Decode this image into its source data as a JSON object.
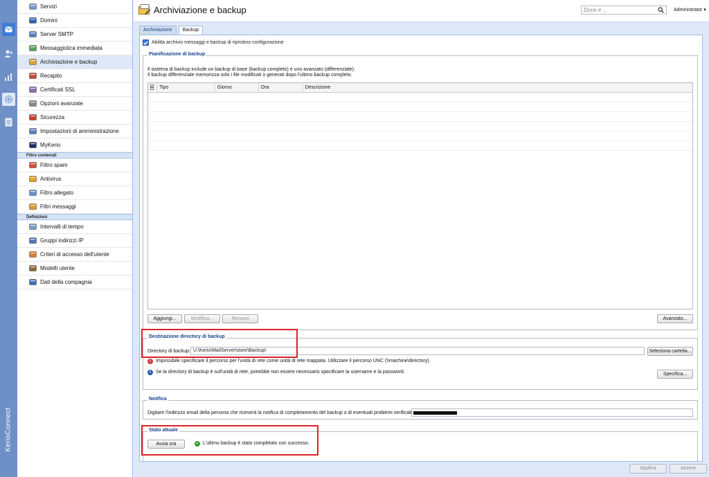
{
  "rail": {
    "brand": "KerioConnect"
  },
  "sidebar": {
    "items_top": [
      {
        "label": "Servizi",
        "icon": "services-icon"
      },
      {
        "label": "Domini",
        "icon": "at-icon"
      },
      {
        "label": "Server SMTP",
        "icon": "smtp-icon"
      },
      {
        "label": "Messaggistica immediata",
        "icon": "chat-icon"
      },
      {
        "label": "Archiviazione e backup",
        "icon": "archive-icon"
      },
      {
        "label": "Recapito",
        "icon": "delivery-icon"
      },
      {
        "label": "Certificati SSL",
        "icon": "certificate-icon"
      },
      {
        "label": "Opzioni avanzate",
        "icon": "gear-icon"
      },
      {
        "label": "Sicurezza",
        "icon": "security-icon"
      },
      {
        "label": "Impostazioni di amministrazione",
        "icon": "admin-settings-icon"
      },
      {
        "label": "MyKerio",
        "icon": "mykerio-icon"
      }
    ],
    "section_filters": "Filtro contenuti",
    "items_filters": [
      {
        "label": "Filtro spam",
        "icon": "spam-filter-icon"
      },
      {
        "label": "Antivirus",
        "icon": "antivirus-icon"
      },
      {
        "label": "Filtro allegato",
        "icon": "attachment-filter-icon"
      },
      {
        "label": "Filtri messaggi",
        "icon": "message-filter-icon"
      }
    ],
    "section_definitions": "Definizioni",
    "items_definitions": [
      {
        "label": "Intervalli di tempo",
        "icon": "time-interval-icon"
      },
      {
        "label": "Gruppi indirizzi IP",
        "icon": "ip-group-icon"
      },
      {
        "label": "Criteri di accesso dell'utente",
        "icon": "access-policy-icon"
      },
      {
        "label": "Modelli utente",
        "icon": "user-template-icon"
      },
      {
        "label": "Dati della compagnia",
        "icon": "company-data-icon"
      }
    ]
  },
  "header": {
    "title": "Archiviazione e backup",
    "search_placeholder": "Dove è ...",
    "user": "Administrator"
  },
  "tabs": [
    {
      "label": "Archiviazione"
    },
    {
      "label": "Backup"
    }
  ],
  "backup": {
    "enable_label": "Abilita archivio messaggi e backup di ripristino configurazione",
    "schedule": {
      "legend": "Pianificazione di backup",
      "desc1": "Il sistema di backup include un backup di base (backup completo) e uno avanzato (differenziale).",
      "desc2": "Il backup differenziale memorizza solo i file modificati o generati dopo l'ultimo backup completo.",
      "columns": [
        "Tipo",
        "Giorno",
        "Ora",
        "Descrizione"
      ],
      "btn_add": "Aggiungi...",
      "btn_edit": "Modifica...",
      "btn_remove": "Rimuovi",
      "btn_advanced": "Avanzato..."
    },
    "destination": {
      "legend": "Destinazione directory di backup",
      "label": "Directory di backup:",
      "value": "U:\\Kerio\\MailServer\\store\\Backup\\",
      "btn_select": "Seleziona cartella...",
      "error_text": "Impossibile specificare il percorso per l'unità di rete come unità di rete mappata. Utilizzare il percorso UNC (\\\\machine\\directory).",
      "info_text": "Se la directory di backup è sull'unità di rete, potrebbe non essere necessario specificare la username e la password.",
      "btn_specify": "Specifica..."
    },
    "notification": {
      "legend": "Notifica",
      "label": "Digitare l'indirizzo email della persona che riceverà la notifica di completamento del backup o di eventuali problemi verificatisi:"
    },
    "status": {
      "legend": "Stato attuale",
      "btn_start": "Avvia ora",
      "message": "L'ultimo backup è stato completato con successo."
    }
  },
  "footer": {
    "apply": "Applica",
    "reset": "Azzera"
  },
  "colors": {
    "highlight": "#d9222a",
    "accent": "#15428b",
    "success": "#2aa52a"
  }
}
